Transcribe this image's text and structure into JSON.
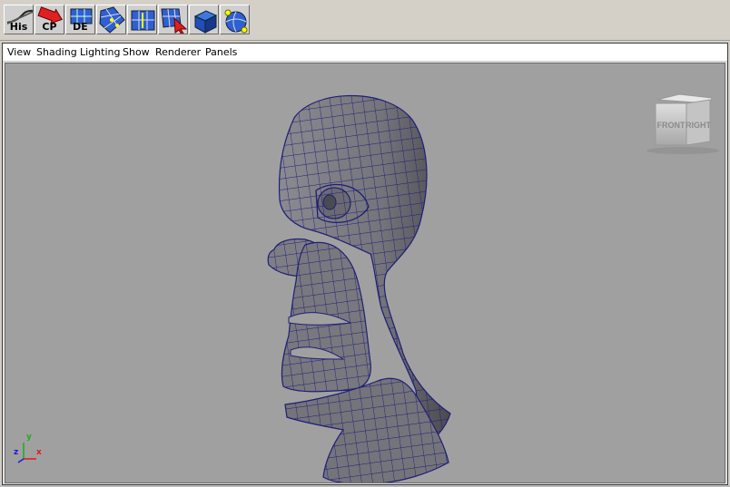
{
  "shelf": {
    "buttons": [
      {
        "name": "history-button",
        "label": "His",
        "icon": "curve-icon"
      },
      {
        "name": "cp-button",
        "label": "CP",
        "icon": "red-arrow-icon"
      },
      {
        "name": "de-button",
        "label": "DE",
        "icon": "grid-icon"
      },
      {
        "name": "mesh-tool-1-button",
        "label": "",
        "icon": "mesh-split-icon"
      },
      {
        "name": "mesh-tool-2-button",
        "label": "",
        "icon": "mesh-insert-icon"
      },
      {
        "name": "mesh-tool-3-button",
        "label": "",
        "icon": "mesh-select-icon"
      },
      {
        "name": "cube-tool-button",
        "label": "",
        "icon": "cube-icon"
      },
      {
        "name": "sphere-tool-button",
        "label": "",
        "icon": "sphere-icon"
      }
    ]
  },
  "panel_menu": {
    "items": [
      "View",
      "Shading",
      "Lighting",
      "Show",
      "Renderer",
      "Panels"
    ]
  },
  "viewcube": {
    "front": "FRONT",
    "right": "RIGHT"
  },
  "viewport": {
    "camera": "persp",
    "axis": {
      "x": "x",
      "y": "y",
      "z": "z"
    }
  },
  "colors": {
    "viewport_bg": "#a0a0a0",
    "mesh_wire": "#1e1e78",
    "mesh_fill": "#7c7c82"
  }
}
